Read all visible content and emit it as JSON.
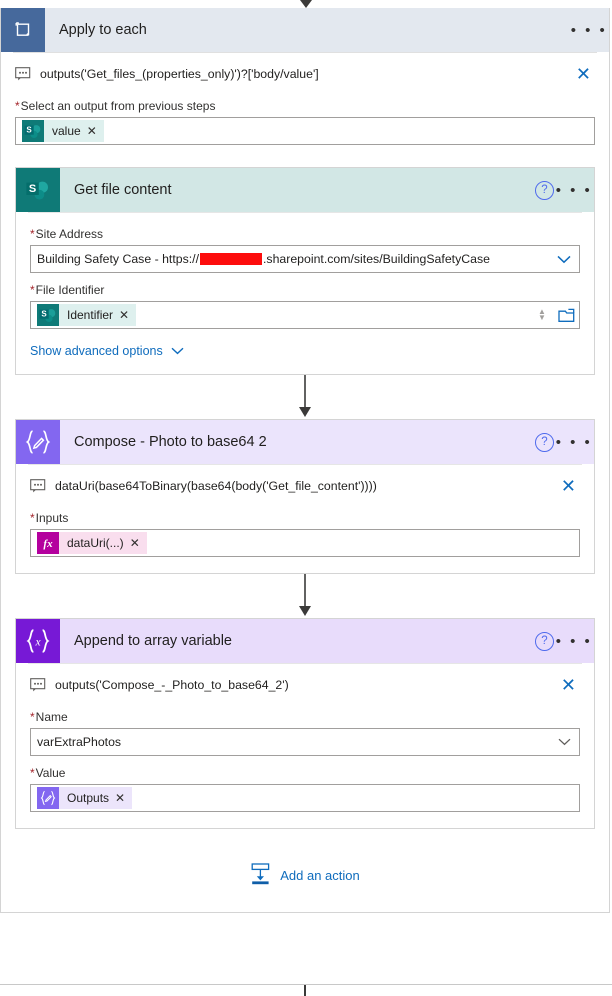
{
  "loop": {
    "title": "Apply to each",
    "icon": "loop-icon",
    "more_label": "• • •",
    "expression": "outputs('Get_files_(properties_only)')?['body/value']",
    "expression_icon": "comment-icon",
    "close_label": "✕",
    "select_output": {
      "label": "Select an output from previous steps",
      "required": true,
      "token": {
        "label": "value",
        "icon": "sharepoint-icon",
        "remove_label": "✕"
      }
    }
  },
  "get_file_content": {
    "title": "Get file content",
    "icon": "sharepoint-icon",
    "help_label": "?",
    "more_label": "• • •",
    "site_address": {
      "label": "Site Address",
      "required": true,
      "value_prefix": "Building Safety Case - https://",
      "value_redacted": true,
      "value_suffix": ".sharepoint.com/sites/BuildingSafetyCase"
    },
    "file_identifier": {
      "label": "File Identifier",
      "required": true,
      "token": {
        "label": "Identifier",
        "icon": "sharepoint-icon",
        "remove_label": "✕"
      },
      "spinner_up": "▲",
      "spinner_down": "▼",
      "picker_icon": "folder-icon"
    },
    "advanced_link": "Show advanced options"
  },
  "compose": {
    "title": "Compose - Photo to base64 2",
    "icon": "compose-braces-pencil-icon",
    "help_label": "?",
    "more_label": "• • •",
    "expression": "dataUri(base64ToBinary(base64(body('Get_file_content'))))",
    "expression_icon": "comment-icon",
    "close_label": "✕",
    "inputs": {
      "label": "Inputs",
      "required": true,
      "token": {
        "label": "dataUri(...)",
        "icon": "fx-icon",
        "remove_label": "✕"
      }
    }
  },
  "append": {
    "title": "Append to array variable",
    "icon": "braces-x-icon",
    "help_label": "?",
    "more_label": "• • •",
    "expression": "outputs('Compose_-_Photo_to_base64_2')",
    "expression_icon": "comment-icon",
    "close_label": "✕",
    "name_field": {
      "label": "Name",
      "required": true,
      "value": "varExtraPhotos",
      "chevron_icon": "chevron-down-icon"
    },
    "value_field": {
      "label": "Value",
      "required": true,
      "token": {
        "label": "Outputs",
        "icon": "outputs-icon",
        "remove_label": "✕"
      }
    }
  },
  "add_action": {
    "label": "Add an action",
    "icon": "add-action-icon"
  },
  "colors": {
    "loop_header": "#e3e8ef",
    "loop_icon": "#46699c",
    "sharepoint_header": "#d2e7e5",
    "sharepoint_icon": "#0f7a77",
    "compose_header": "#ebe4fc",
    "compose_icon": "#8367f0",
    "append_header": "#e8dcfb",
    "append_icon": "#7719d6",
    "link_blue": "#0f6cbd",
    "required_red": "#a4262c",
    "redaction_red": "#fd0d0d"
  }
}
